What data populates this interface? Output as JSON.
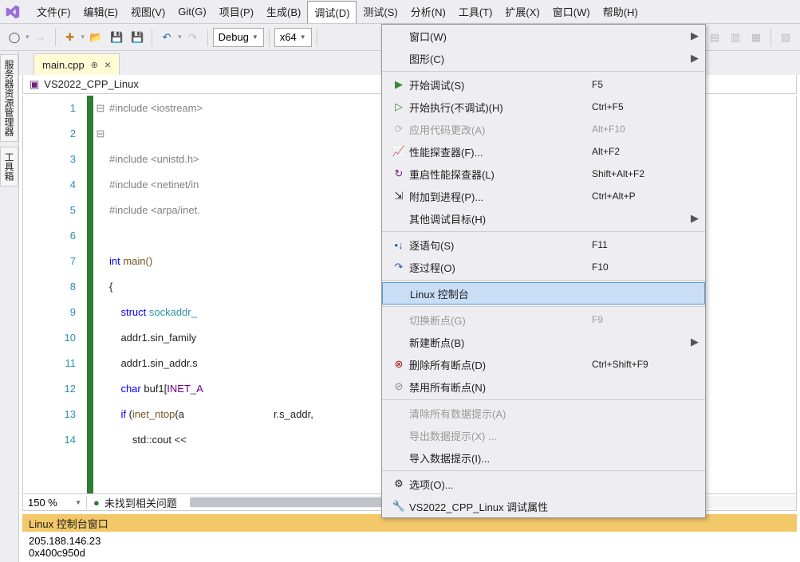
{
  "menubar": {
    "items": [
      "文件(F)",
      "编辑(E)",
      "视图(V)",
      "Git(G)",
      "项目(P)",
      "生成(B)",
      "调试(D)",
      "测试(S)",
      "分析(N)",
      "工具(T)",
      "扩展(X)",
      "窗口(W)",
      "帮助(H)"
    ],
    "active_index": 6
  },
  "toolbar": {
    "config": "Debug",
    "platform": "x64"
  },
  "dock": {
    "tab1": "服务器资源管理器",
    "tab2": "工具箱"
  },
  "file_tab": {
    "name": "main.cpp"
  },
  "crumb": {
    "project": "VS2022_CPP_Linux"
  },
  "code_lines": {
    "l1": "#include <iostream>",
    "l2": "",
    "l3": "#include <unistd.h>",
    "l4": "#include <netinet/in",
    "l5": "#include <arpa/inet.",
    "l6": "",
    "l7_a": "int",
    "l7_b": " main()",
    "l8": "{",
    "l9_a": "    ",
    "l9_b": "struct",
    "l9_c": " sockaddr_",
    "l10_a": "    addr1.sin_family",
    "l11_a": "    addr1.sin_addr.s",
    "l12_a": "    ",
    "l12_b": "char",
    "l12_c": " buf1[",
    "l12_d": "INET_A",
    "l13_a": "    ",
    "l13_b": "if",
    "l13_c": " (",
    "l13_d": "inet_ntop",
    "l13_e": "(a",
    "l13_tail": "r.s_addr,",
    "l14_a": "        std::cout <<"
  },
  "line_numbers": [
    "1",
    "2",
    "3",
    "4",
    "5",
    "6",
    "7",
    "8",
    "9",
    "10",
    "11",
    "12",
    "13",
    "14"
  ],
  "status": {
    "zoom": "150 %",
    "issues": "未找到相关问题"
  },
  "console": {
    "title": "Linux 控制台窗口",
    "line1": "205.188.146.23",
    "line2": "0x400c950d"
  },
  "dropdown": [
    {
      "label": "窗口(W)",
      "arrow": true
    },
    {
      "label": "图形(C)",
      "arrow": true
    },
    {
      "sep": true
    },
    {
      "icon": "play-green",
      "label": "开始调试(S)",
      "sc": "F5"
    },
    {
      "icon": "play-outline",
      "label": "开始执行(不调试)(H)",
      "sc": "Ctrl+F5"
    },
    {
      "icon": "refresh-dis",
      "label": "应用代码更改(A)",
      "sc": "Alt+F10",
      "disabled": true
    },
    {
      "icon": "perf",
      "label": "性能探查器(F)...",
      "sc": "Alt+F2"
    },
    {
      "icon": "perf-restart",
      "label": "重启性能探查器(L)",
      "sc": "Shift+Alt+F2"
    },
    {
      "icon": "attach",
      "label": "附加到进程(P)...",
      "sc": "Ctrl+Alt+P"
    },
    {
      "label": "其他调试目标(H)",
      "arrow": true
    },
    {
      "sep": true
    },
    {
      "icon": "step-into",
      "label": "逐语句(S)",
      "sc": "F11"
    },
    {
      "icon": "step-over",
      "label": "逐过程(O)",
      "sc": "F10"
    },
    {
      "sep": true
    },
    {
      "label": "Linux 控制台",
      "hl": true
    },
    {
      "sep": true
    },
    {
      "label": "切换断点(G)",
      "sc": "F9",
      "disabled": true
    },
    {
      "label": "新建断点(B)",
      "arrow": true
    },
    {
      "icon": "del-bp",
      "label": "删除所有断点(D)",
      "sc": "Ctrl+Shift+F9"
    },
    {
      "icon": "dis-bp",
      "label": "禁用所有断点(N)"
    },
    {
      "sep": true
    },
    {
      "label": "清除所有数据提示(A)",
      "disabled": true
    },
    {
      "label": "导出数据提示(X) ...",
      "disabled": true
    },
    {
      "label": "导入数据提示(I)..."
    },
    {
      "sep": true
    },
    {
      "icon": "gear",
      "label": "选项(O)..."
    },
    {
      "icon": "wrench",
      "label": "VS2022_CPP_Linux 调试属性"
    }
  ]
}
